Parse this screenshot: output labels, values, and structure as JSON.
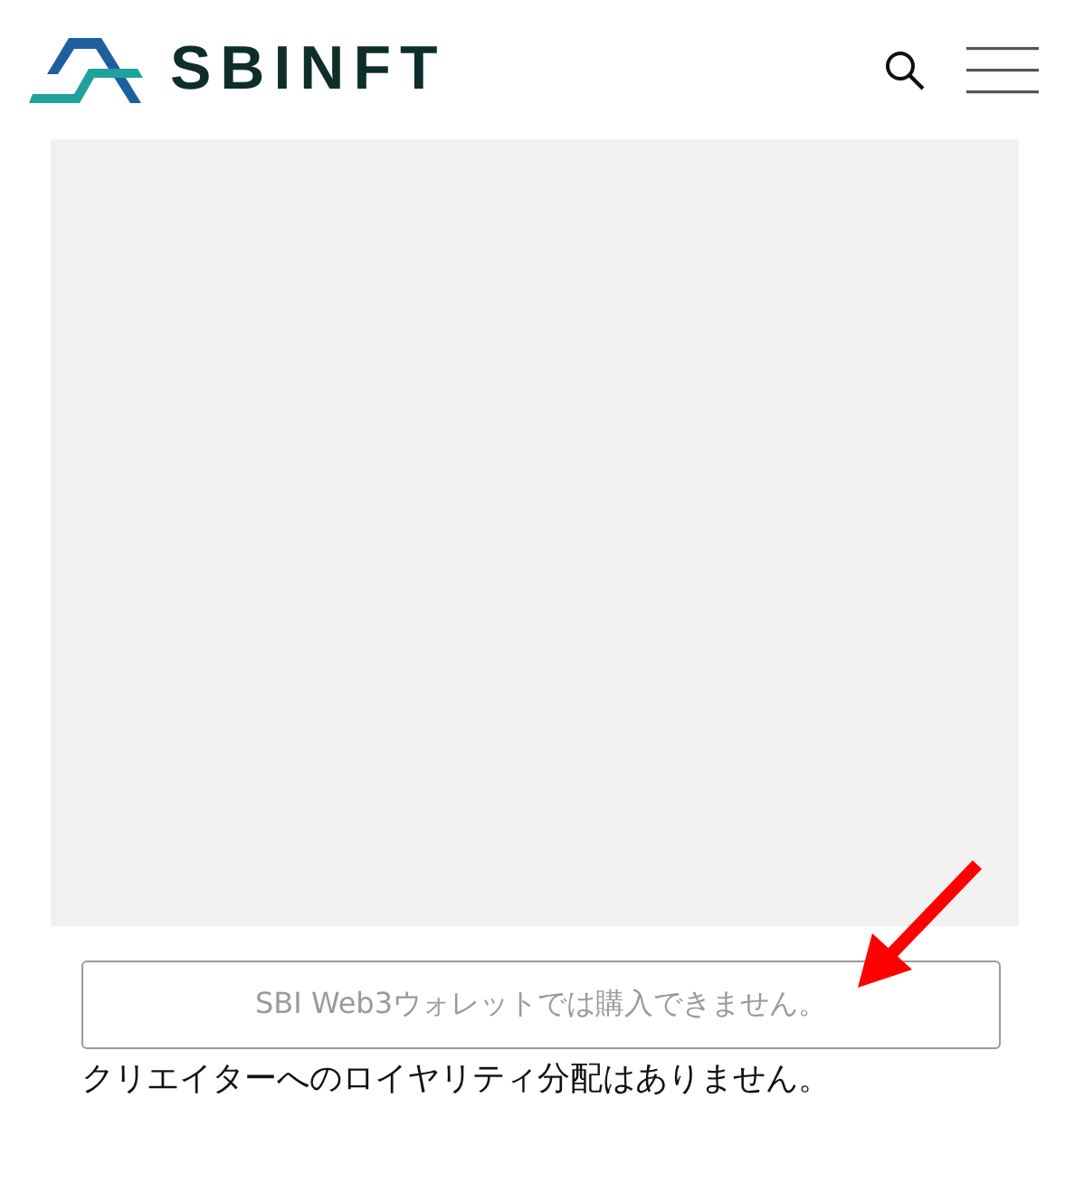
{
  "header": {
    "logo_text": "SBINFT"
  },
  "purchase_button": {
    "label": "SBI Web3ウォレットでは購入できません。",
    "disabled": true
  },
  "note": "クリエイターへのロイヤリティ分配はありません。"
}
